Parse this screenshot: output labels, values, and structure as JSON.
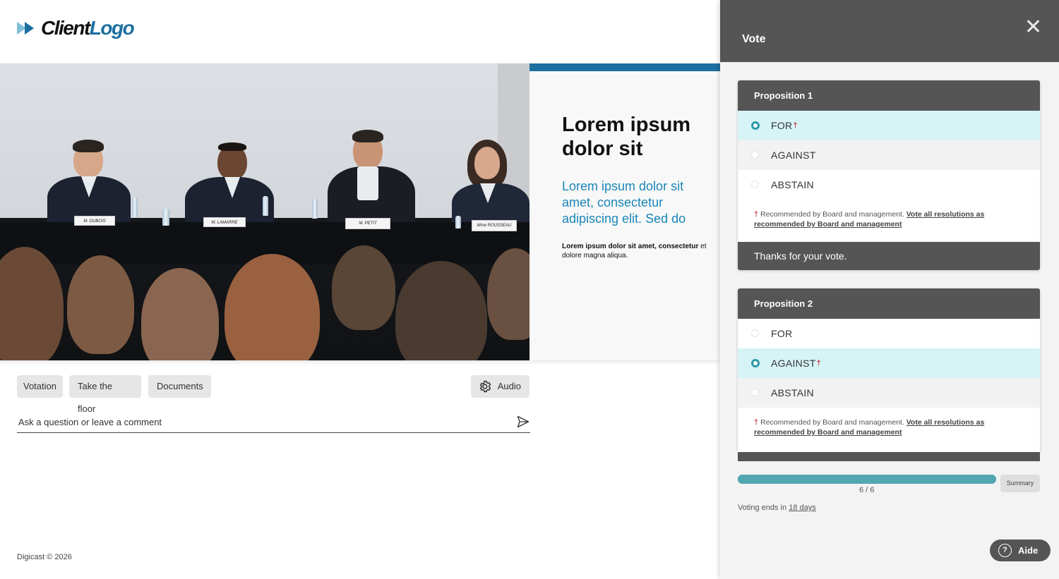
{
  "logo": {
    "part1": "Client",
    "part2": "Logo"
  },
  "stage": {
    "nameplates": [
      "M. DUBOIS",
      "M. LAMARRE",
      "M. PETIT",
      "Mme ROUSSEAU"
    ],
    "slide": {
      "title": "Lorem ipsum dolor sit",
      "subtitle": "Lorem ipsum dolor sit amet, consectetur adipiscing elit. Sed do",
      "small_bold": "Lorem ipsum dolor sit amet, consectetur",
      "small_rest": " et dolore magna aliqua."
    }
  },
  "actions": {
    "votation": "Votation",
    "take_floor": "Take the floor",
    "documents": "Documents",
    "audio": "Audio"
  },
  "comment": {
    "placeholder": "Ask a question or leave a comment"
  },
  "footer": "Digicast © 2026",
  "panel": {
    "title": "Vote",
    "propositions": [
      {
        "title": "Proposition 1",
        "options": [
          "FOR",
          "AGAINST",
          "ABSTAIN"
        ],
        "selected": "FOR",
        "recommended": "FOR",
        "note": "Recommended by Board and management.",
        "note_link": "Vote all resolutions as recommended by Board and management",
        "thanks": "Thanks for your vote."
      },
      {
        "title": "Proposition 2",
        "options": [
          "FOR",
          "AGAINST",
          "ABSTAIN"
        ],
        "selected": "AGAINST",
        "recommended": "AGAINST",
        "note": "Recommended by Board and management.",
        "note_link": "Vote all resolutions as recommended by Board and management"
      }
    ],
    "dagger": "†",
    "progress": {
      "done": 6,
      "total": 6,
      "label": "6 / 6"
    },
    "summary": "Summary",
    "ends_prefix": "Voting ends in",
    "ends_value": "18 days",
    "help": "Aide",
    "help_glyph": "?"
  },
  "colors": {
    "accent": "#1d6fa0",
    "accent_light": "#1a86b8",
    "panel_dark": "#555555",
    "selected_bg": "#d6f3f6",
    "radio_selected": "#2f9aa8",
    "recommend_red": "#c0141b",
    "progress": "#52a7b0"
  }
}
